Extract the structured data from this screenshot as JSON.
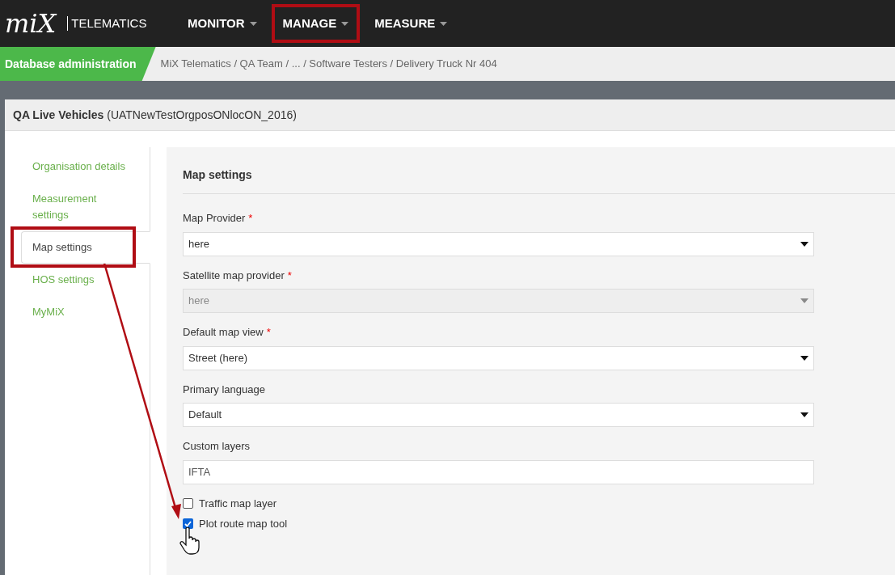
{
  "logo": {
    "mark": "miX",
    "product": "TELEMATICS"
  },
  "nav": [
    {
      "label": "MONITOR",
      "highlighted": false
    },
    {
      "label": "MANAGE",
      "highlighted": true
    },
    {
      "label": "MEASURE",
      "highlighted": false
    }
  ],
  "section": "Database administration",
  "breadcrumb": "MiX Telematics / QA Team / ... / Software Testers / Delivery Truck Nr 404",
  "card": {
    "title": "QA Live Vehicles",
    "subtitle": "(UATNewTestOrgposONlocON_2016)"
  },
  "sidebar": {
    "items": [
      {
        "label": "Organisation details",
        "selected": false,
        "highlighted": false
      },
      {
        "label": "Measurement settings",
        "selected": false,
        "highlighted": false
      },
      {
        "label": "Map settings",
        "selected": true,
        "highlighted": true
      },
      {
        "label": "HOS settings",
        "selected": false,
        "highlighted": false
      },
      {
        "label": "MyMiX",
        "selected": false,
        "highlighted": false
      }
    ]
  },
  "panel": {
    "title": "Map settings",
    "fields": [
      {
        "kind": "select",
        "label": "Map Provider",
        "required": true,
        "value": "here",
        "disabled": false
      },
      {
        "kind": "select",
        "label": "Satellite map provider",
        "required": true,
        "value": "here",
        "disabled": true
      },
      {
        "kind": "select",
        "label": "Default map view",
        "required": true,
        "value": "Street (here)",
        "disabled": false
      },
      {
        "kind": "select",
        "label": "Primary language",
        "required": false,
        "value": "Default",
        "disabled": false
      },
      {
        "kind": "text",
        "label": "Custom layers",
        "required": false,
        "value": "IFTA",
        "disabled": false
      }
    ],
    "required_mark": "*",
    "checkboxes": [
      {
        "label": "Traffic map layer",
        "checked": false
      },
      {
        "label": "Plot route map tool",
        "checked": true
      }
    ]
  }
}
